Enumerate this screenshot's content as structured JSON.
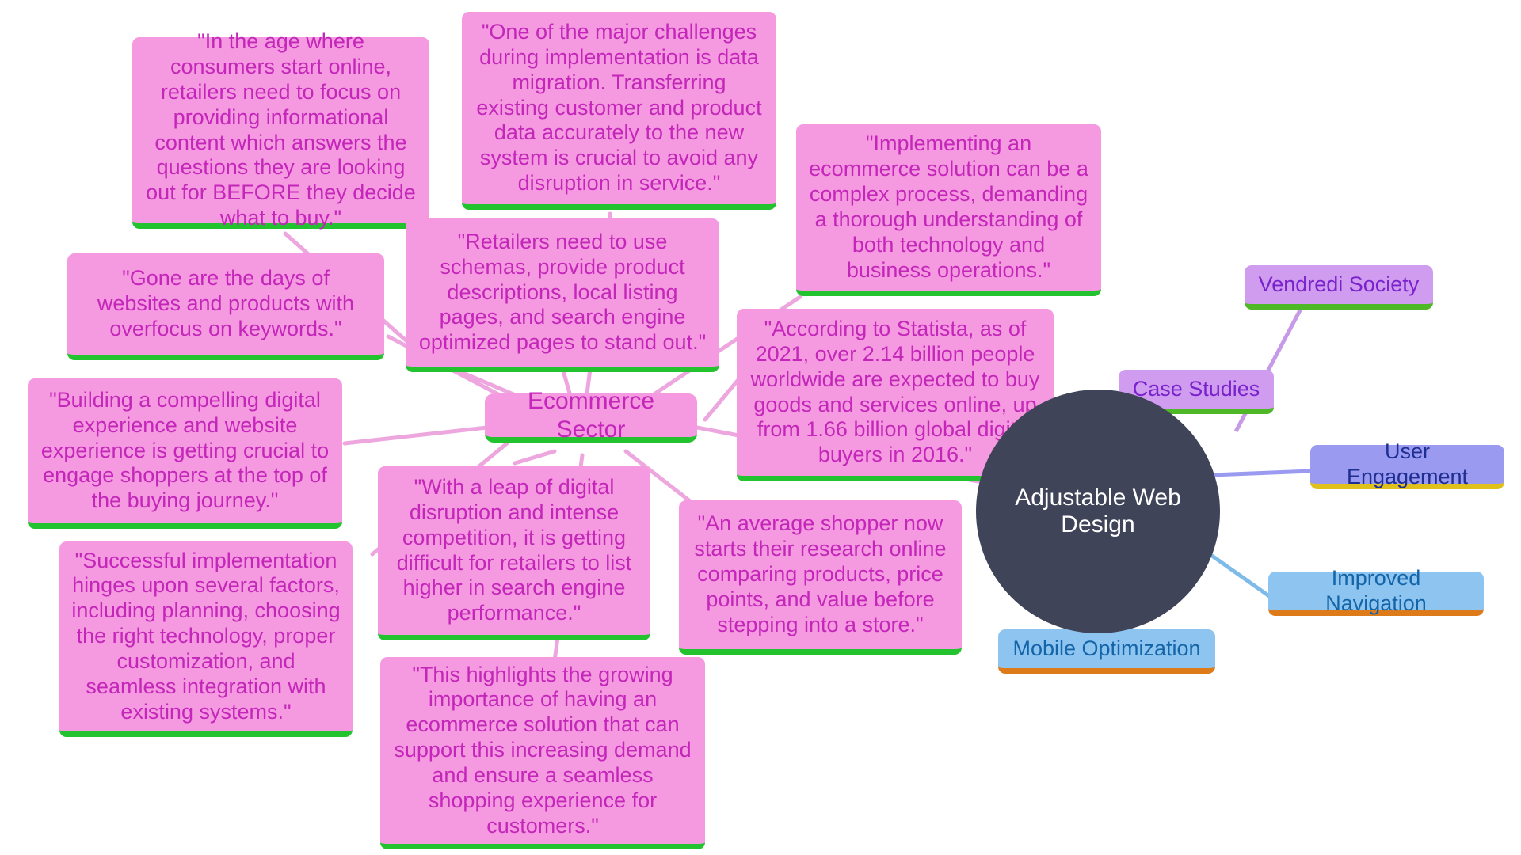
{
  "diagram": {
    "type": "mind-map",
    "background": "#ffffff",
    "center": {
      "label": "Adjustable Web Design",
      "shape": "ellipse",
      "fill": "#3f4458",
      "text_color": "#ffffff"
    },
    "hub": {
      "label": "Ecommerce Sector",
      "fill": "#f59ae0",
      "text_color": "#c326b9",
      "underline": "#22c32e"
    },
    "quotes": [
      {
        "id": "q1",
        "text": "\"In the age where consumers start online, retailers need to focus on providing informational content which answers the questions they are looking out for BEFORE they decide what to buy.\""
      },
      {
        "id": "q2",
        "text": "\"One of the major challenges during implementation is data migration. Transferring existing customer and product data accurately to the new system is crucial to avoid any disruption in service.\""
      },
      {
        "id": "q3",
        "text": "\"Implementing an ecommerce solution can be a complex process, demanding a thorough understanding of both technology and business operations.\""
      },
      {
        "id": "q4",
        "text": "\"Gone are the days of websites and products with overfocus on keywords.\""
      },
      {
        "id": "q5",
        "text": "\"Retailers need to use schemas, provide product descriptions, local listing pages, and search engine optimized pages to stand out.\""
      },
      {
        "id": "q6",
        "text": "\"According to Statista, as of 2021, over 2.14 billion people worldwide are expected to buy goods and services online, up from 1.66 billion global digital buyers in 2016.\""
      },
      {
        "id": "q7",
        "text": "\"Building a compelling digital experience and website experience is getting crucial to engage shoppers at the top of the buying journey.\""
      },
      {
        "id": "q8",
        "text": "\"Successful implementation hinges upon several factors, including planning, choosing the right technology, proper customization, and seamless integration with existing systems.\""
      },
      {
        "id": "q9",
        "text": "\"With a leap of digital disruption and intense competition, it is getting difficult for retailers to list higher in search engine performance.\""
      },
      {
        "id": "q10",
        "text": "\"An average shopper now starts their research online comparing products, price points, and value before stepping into a store.\""
      },
      {
        "id": "q11",
        "text": "\"This highlights the growing importance of having an ecommerce solution that can support this increasing demand and ensure a seamless shopping experience for customers.\""
      }
    ],
    "branches": [
      {
        "id": "b1",
        "label": "Vendredi Society",
        "fill": "#cf9cef",
        "text_color": "#7a22cc",
        "underline": "#4fb827"
      },
      {
        "id": "b2",
        "label": "Case Studies",
        "fill": "#cf9cef",
        "text_color": "#7a22cc",
        "underline": "#4fb827"
      },
      {
        "id": "b3",
        "label": "User Engagement",
        "fill": "#9a9af0",
        "text_color": "#1f2f91",
        "underline": "#e0c01b"
      },
      {
        "id": "b4",
        "label": "Improved Navigation",
        "fill": "#8ec5f0",
        "text_color": "#1464a8",
        "underline": "#dd7b1b"
      },
      {
        "id": "b5",
        "label": "Mobile Optimization",
        "fill": "#8ec5f0",
        "text_color": "#1464a8",
        "underline": "#dd7b1b"
      }
    ],
    "edge_colors": {
      "pink": "#eda6de",
      "purple": "#c79ae8",
      "indigo": "#9a9af0",
      "blue": "#7fbbe8"
    }
  }
}
